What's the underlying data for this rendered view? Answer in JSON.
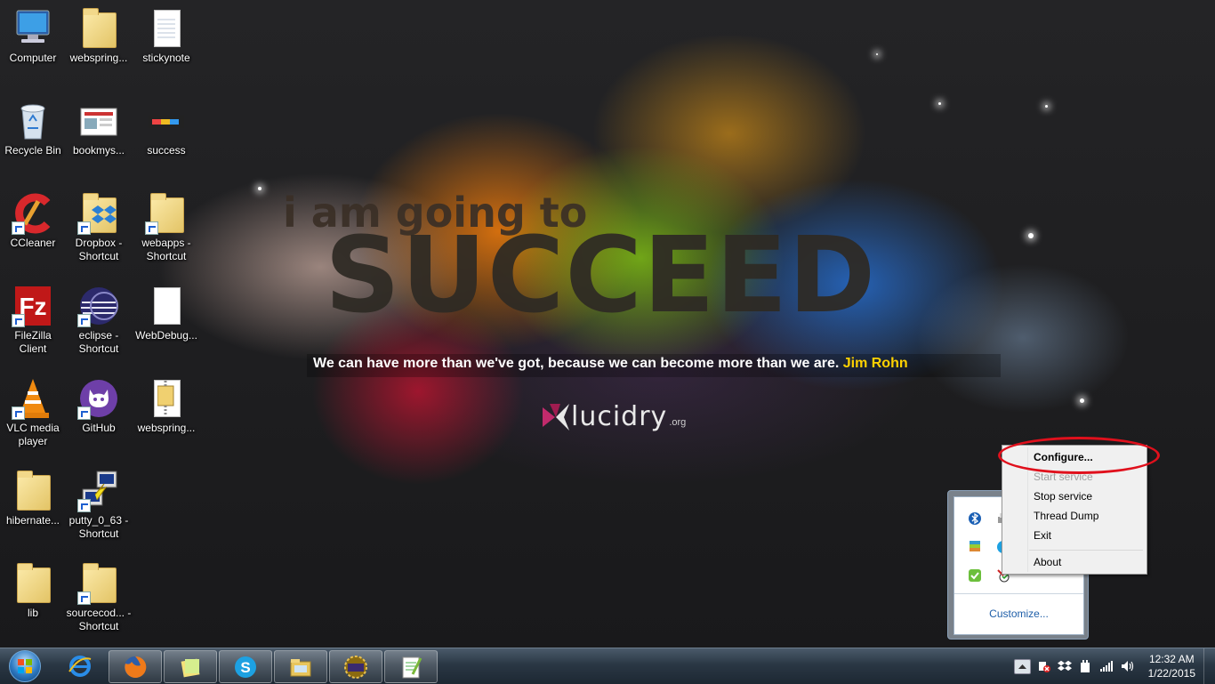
{
  "wallpaper": {
    "line1": "i am going to",
    "line2": "SUCCEED",
    "quote": "We can have more than we've got, because we can become more than we are.",
    "author": "Jim Rohn",
    "logo": "lucidry",
    "logo_suffix": ".org"
  },
  "desktop_icons": [
    {
      "label": "Computer",
      "icon": "computer-icon"
    },
    {
      "label": "webspring...",
      "icon": "folder-icon"
    },
    {
      "label": "stickynote",
      "icon": "text-file-icon"
    },
    {
      "label": "Recycle Bin",
      "icon": "recycle-bin-icon"
    },
    {
      "label": "bookmys...",
      "icon": "image-file-icon"
    },
    {
      "label": "success",
      "icon": "image-file-icon"
    },
    {
      "label": "CCleaner",
      "icon": "ccleaner-icon"
    },
    {
      "label": "Dropbox - Shortcut",
      "icon": "dropbox-icon"
    },
    {
      "label": "webapps - Shortcut",
      "icon": "folder-icon"
    },
    {
      "label": "FileZilla Client",
      "icon": "filezilla-icon"
    },
    {
      "label": "eclipse - Shortcut",
      "icon": "eclipse-icon"
    },
    {
      "label": "WebDebug...",
      "icon": "file-icon"
    },
    {
      "label": "VLC media player",
      "icon": "vlc-icon"
    },
    {
      "label": "GitHub",
      "icon": "github-icon"
    },
    {
      "label": "webspring...",
      "icon": "zip-file-icon"
    },
    {
      "label": "hibernate...",
      "icon": "folder-icon"
    },
    {
      "label": "putty_0_63 - Shortcut",
      "icon": "putty-icon"
    },
    {
      "label": "lib",
      "icon": "folder-icon"
    },
    {
      "label": "sourcecod... - Shortcut",
      "icon": "folder-icon"
    }
  ],
  "context_menu": {
    "items": [
      {
        "label": "Configure...",
        "state": "default"
      },
      {
        "label": "Start service",
        "state": "disabled"
      },
      {
        "label": "Stop service",
        "state": "normal"
      },
      {
        "label": "Thread Dump",
        "state": "normal"
      },
      {
        "label": "Exit",
        "state": "normal"
      },
      {
        "label": "About",
        "state": "normal"
      }
    ]
  },
  "tray_overflow": {
    "customize_label": "Customize..."
  },
  "taskbar": {
    "pinned": [
      "internet-explorer-icon",
      "firefox-icon",
      "sticky-notes-icon",
      "skype-icon",
      "windows-explorer-icon",
      "java-ee-ide-icon",
      "notepad-plus-plus-icon"
    ],
    "clock_time": "12:32 AM",
    "clock_date": "1/22/2015"
  },
  "colors": {
    "highlight_ring": "#e0101c",
    "quote_author": "#ffd200"
  }
}
